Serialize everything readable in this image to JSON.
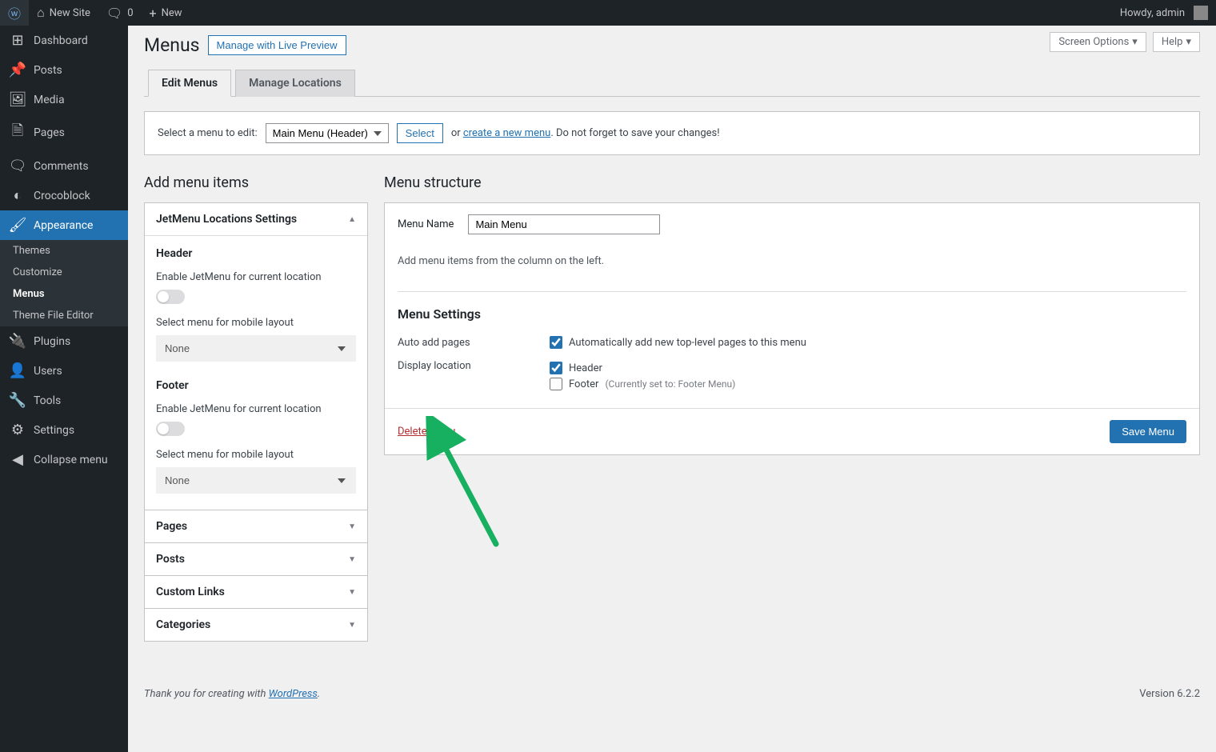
{
  "admin_bar": {
    "site_name": "New Site",
    "comments_count": "0",
    "new_label": "New",
    "howdy": "Howdy, admin"
  },
  "sidebar": {
    "items": [
      {
        "label": "Dashboard",
        "icon": "dashboard"
      },
      {
        "label": "Posts",
        "icon": "pin"
      },
      {
        "label": "Media",
        "icon": "media"
      },
      {
        "label": "Pages",
        "icon": "page"
      },
      {
        "label": "Comments",
        "icon": "comment"
      },
      {
        "label": "Crocoblock",
        "icon": "croco"
      },
      {
        "label": "Appearance",
        "icon": "brush"
      },
      {
        "label": "Plugins",
        "icon": "plug"
      },
      {
        "label": "Users",
        "icon": "user"
      },
      {
        "label": "Tools",
        "icon": "wrench"
      },
      {
        "label": "Settings",
        "icon": "sliders"
      },
      {
        "label": "Collapse menu",
        "icon": "collapse"
      }
    ],
    "submenu": [
      {
        "label": "Themes"
      },
      {
        "label": "Customize"
      },
      {
        "label": "Menus"
      },
      {
        "label": "Theme File Editor"
      }
    ]
  },
  "top_actions": {
    "screen_options": "Screen Options",
    "help": "Help"
  },
  "page": {
    "title": "Menus",
    "live_preview_btn": "Manage with Live Preview"
  },
  "tabs": {
    "edit": "Edit Menus",
    "locations": "Manage Locations"
  },
  "select_bar": {
    "prefix": "Select a menu to edit:",
    "selected": "Main Menu (Header)",
    "select_btn": "Select",
    "or": "or",
    "create_link": "create a new menu",
    "suffix": ". Do not forget to save your changes!"
  },
  "left": {
    "title": "Add menu items",
    "jetmenu": {
      "panel_title": "JetMenu Locations Settings",
      "header_title": "Header",
      "enable_label": "Enable JetMenu for current location",
      "mobile_label": "Select menu for mobile layout",
      "mobile_value": "None",
      "footer_title": "Footer"
    },
    "other_panels": [
      "Pages",
      "Posts",
      "Custom Links",
      "Categories"
    ]
  },
  "right": {
    "title": "Menu structure",
    "name_label": "Menu Name",
    "name_value": "Main Menu",
    "hint": "Add menu items from the column on the left.",
    "settings_title": "Menu Settings",
    "auto_add_label": "Auto add pages",
    "auto_add_check": "Automatically add new top-level pages to this menu",
    "display_label": "Display location",
    "loc_header": "Header",
    "loc_footer": "Footer",
    "loc_footer_note": "(Currently set to: Footer Menu)",
    "delete": "Delete Menu",
    "save": "Save Menu"
  },
  "footer": {
    "thanks_prefix": "Thank you for creating with ",
    "wordpress": "WordPress",
    "period": ".",
    "version": "Version 6.2.2"
  }
}
